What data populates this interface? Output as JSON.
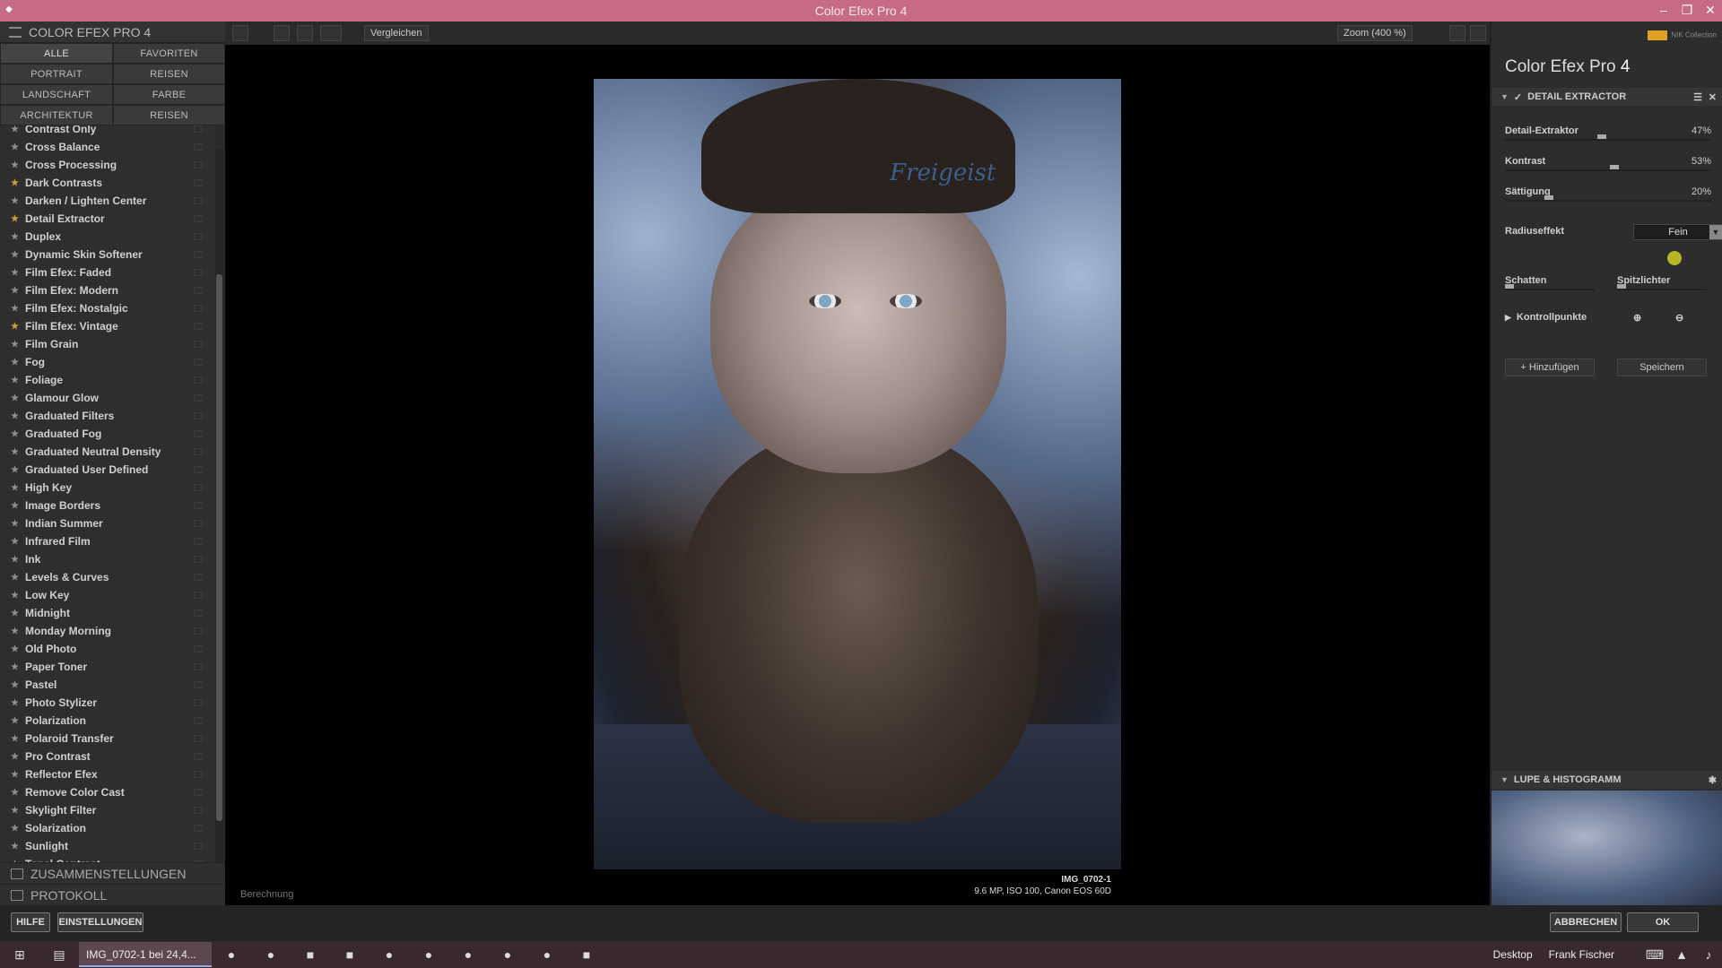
{
  "window": {
    "title": "Color Efex Pro 4"
  },
  "left": {
    "header": "COLOR EFEX PRO 4",
    "categories": [
      "ALLE",
      "FAVORITEN",
      "PORTRAIT",
      "REISEN",
      "LANDSCHAFT",
      "FARBE",
      "ARCHITEKTUR",
      "REISEN"
    ],
    "filters": [
      {
        "name": "Contrast Only",
        "fav": false
      },
      {
        "name": "Cross Balance",
        "fav": false
      },
      {
        "name": "Cross Processing",
        "fav": false
      },
      {
        "name": "Dark Contrasts",
        "fav": true
      },
      {
        "name": "Darken / Lighten Center",
        "fav": false
      },
      {
        "name": "Detail Extractor",
        "fav": true
      },
      {
        "name": "Duplex",
        "fav": false
      },
      {
        "name": "Dynamic Skin Softener",
        "fav": false
      },
      {
        "name": "Film Efex: Faded",
        "fav": false
      },
      {
        "name": "Film Efex: Modern",
        "fav": false
      },
      {
        "name": "Film Efex: Nostalgic",
        "fav": false
      },
      {
        "name": "Film Efex: Vintage",
        "fav": true
      },
      {
        "name": "Film Grain",
        "fav": false
      },
      {
        "name": "Fog",
        "fav": false
      },
      {
        "name": "Foliage",
        "fav": false
      },
      {
        "name": "Glamour Glow",
        "fav": false
      },
      {
        "name": "Graduated Filters",
        "fav": false
      },
      {
        "name": "Graduated Fog",
        "fav": false
      },
      {
        "name": "Graduated Neutral Density",
        "fav": false
      },
      {
        "name": "Graduated User Defined",
        "fav": false
      },
      {
        "name": "High Key",
        "fav": false
      },
      {
        "name": "Image Borders",
        "fav": false
      },
      {
        "name": "Indian Summer",
        "fav": false
      },
      {
        "name": "Infrared Film",
        "fav": false
      },
      {
        "name": "Ink",
        "fav": false
      },
      {
        "name": "Levels & Curves",
        "fav": false
      },
      {
        "name": "Low Key",
        "fav": false
      },
      {
        "name": "Midnight",
        "fav": false
      },
      {
        "name": "Monday Morning",
        "fav": false
      },
      {
        "name": "Old Photo",
        "fav": false
      },
      {
        "name": "Paper Toner",
        "fav": false
      },
      {
        "name": "Pastel",
        "fav": false
      },
      {
        "name": "Photo Stylizer",
        "fav": false
      },
      {
        "name": "Polarization",
        "fav": false
      },
      {
        "name": "Polaroid Transfer",
        "fav": false
      },
      {
        "name": "Pro Contrast",
        "fav": false
      },
      {
        "name": "Reflector Efex",
        "fav": false
      },
      {
        "name": "Remove Color Cast",
        "fav": false
      },
      {
        "name": "Skylight Filter",
        "fav": false
      },
      {
        "name": "Solarization",
        "fav": false
      },
      {
        "name": "Sunlight",
        "fav": false
      },
      {
        "name": "Tonal Contrast",
        "fav": false
      }
    ],
    "sections": [
      "ZUSAMMENSTELLUNGEN",
      "PROTOKOLL"
    ]
  },
  "toolbar": {
    "compare": "Vergleichen",
    "zoom": "Zoom (400 %)"
  },
  "canvas": {
    "status": "Berechnung",
    "image_name": "IMG_0702-1",
    "image_info": "9.6 MP, ISO 100, Canon EOS 60D",
    "tattoo_text": "Freigeist"
  },
  "right": {
    "brand": "NIK Collection",
    "title_text": "Color Efex Pro",
    "title_num": "4",
    "filter_header": "DETAIL EXTRACTOR",
    "sliders": [
      {
        "label": "Detail-Extraktor",
        "value": "47%",
        "level": 0.47
      },
      {
        "label": "Kontrast",
        "value": "53%",
        "level": 0.53
      },
      {
        "label": "Sättigung",
        "value": "20%",
        "level": 0.2
      }
    ],
    "radius_label": "Radiuseffekt",
    "radius_value": "Fein",
    "shadows_label": "Schatten",
    "highlights_label": "Spitzlichter",
    "control_points": "Kontrollpunkte",
    "add": "Hinzufügen",
    "save": "Speichern",
    "loupe_header": "LUPE & HISTOGRAMM"
  },
  "bottom": {
    "help": "HILFE",
    "settings": "EINSTELLUNGEN",
    "cancel": "ABBRECHEN",
    "ok": "OK"
  },
  "taskbar": {
    "active_task": "IMG_0702-1 bei 24,4...",
    "desktop": "Desktop",
    "user": "Frank Fischer"
  }
}
